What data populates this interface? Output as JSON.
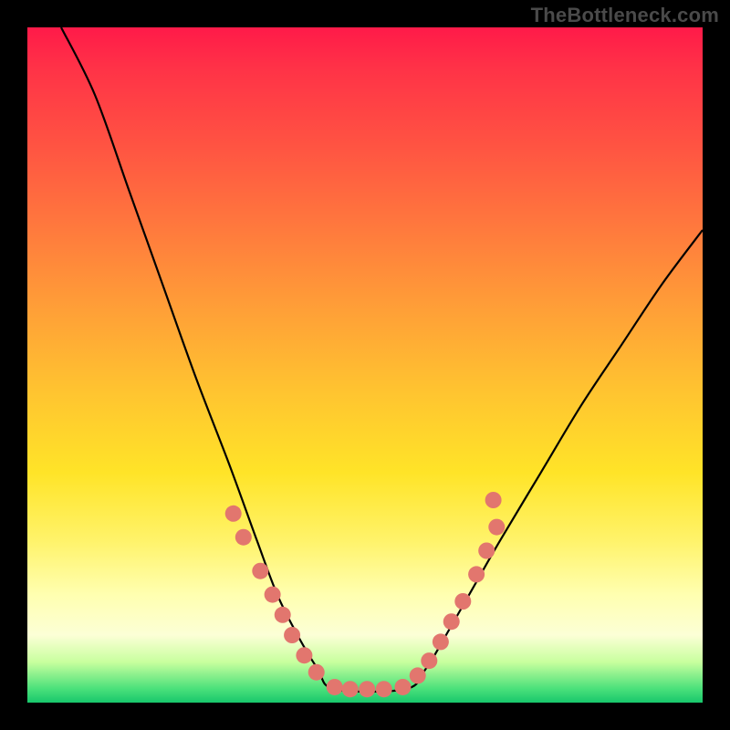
{
  "watermark": "TheBottleneck.com",
  "chart_data": {
    "type": "line",
    "title": "",
    "xlabel": "",
    "ylabel": "",
    "xlim": [
      0,
      1
    ],
    "ylim": [
      0,
      1
    ],
    "curve": {
      "left_branch": [
        {
          "x": 0.05,
          "y": 1.0
        },
        {
          "x": 0.1,
          "y": 0.9
        },
        {
          "x": 0.15,
          "y": 0.76
        },
        {
          "x": 0.2,
          "y": 0.62
        },
        {
          "x": 0.25,
          "y": 0.48
        },
        {
          "x": 0.3,
          "y": 0.35
        },
        {
          "x": 0.34,
          "y": 0.24
        },
        {
          "x": 0.37,
          "y": 0.16
        },
        {
          "x": 0.4,
          "y": 0.1
        },
        {
          "x": 0.43,
          "y": 0.05
        },
        {
          "x": 0.455,
          "y": 0.02
        }
      ],
      "flat_bottom": [
        {
          "x": 0.455,
          "y": 0.02
        },
        {
          "x": 0.56,
          "y": 0.02
        }
      ],
      "right_branch": [
        {
          "x": 0.56,
          "y": 0.02
        },
        {
          "x": 0.59,
          "y": 0.05
        },
        {
          "x": 0.62,
          "y": 0.1
        },
        {
          "x": 0.66,
          "y": 0.17
        },
        {
          "x": 0.7,
          "y": 0.24
        },
        {
          "x": 0.76,
          "y": 0.34
        },
        {
          "x": 0.82,
          "y": 0.44
        },
        {
          "x": 0.88,
          "y": 0.53
        },
        {
          "x": 0.94,
          "y": 0.62
        },
        {
          "x": 1.0,
          "y": 0.7
        }
      ]
    },
    "dots": [
      {
        "x": 0.305,
        "y": 0.28
      },
      {
        "x": 0.32,
        "y": 0.245
      },
      {
        "x": 0.345,
        "y": 0.195
      },
      {
        "x": 0.363,
        "y": 0.16
      },
      {
        "x": 0.378,
        "y": 0.13
      },
      {
        "x": 0.392,
        "y": 0.1
      },
      {
        "x": 0.41,
        "y": 0.07
      },
      {
        "x": 0.428,
        "y": 0.045
      },
      {
        "x": 0.455,
        "y": 0.023
      },
      {
        "x": 0.478,
        "y": 0.02
      },
      {
        "x": 0.503,
        "y": 0.02
      },
      {
        "x": 0.528,
        "y": 0.02
      },
      {
        "x": 0.556,
        "y": 0.023
      },
      {
        "x": 0.578,
        "y": 0.04
      },
      {
        "x": 0.595,
        "y": 0.062
      },
      {
        "x": 0.612,
        "y": 0.09
      },
      {
        "x": 0.628,
        "y": 0.12
      },
      {
        "x": 0.645,
        "y": 0.15
      },
      {
        "x": 0.665,
        "y": 0.19
      },
      {
        "x": 0.68,
        "y": 0.225
      },
      {
        "x": 0.695,
        "y": 0.26
      },
      {
        "x": 0.69,
        "y": 0.3
      }
    ],
    "gradient_bands": [
      {
        "position": 0.0,
        "color": "#ff1a49"
      },
      {
        "position": 0.5,
        "color": "#ffc430"
      },
      {
        "position": 0.85,
        "color": "#ffffb0"
      },
      {
        "position": 1.0,
        "color": "#18c76c"
      }
    ]
  }
}
